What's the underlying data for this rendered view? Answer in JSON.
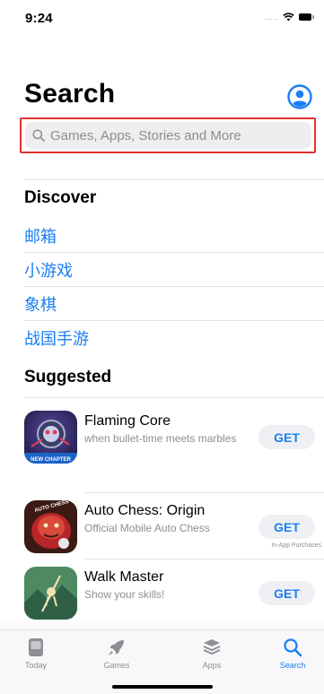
{
  "status_bar": {
    "time": "9:24",
    "signal_text": "....."
  },
  "header": {
    "title": "Search"
  },
  "search": {
    "placeholder": "Games, Apps, Stories and More",
    "value": ""
  },
  "discover": {
    "title": "Discover",
    "items": [
      "邮箱",
      "小游戏",
      "象棋",
      "战国手游"
    ]
  },
  "suggested": {
    "title": "Suggested",
    "apps": [
      {
        "name": "Flaming Core",
        "subtitle": "when bullet-time meets marbles",
        "button": "GET",
        "icon_caption": "NEW CHAPTER",
        "note": ""
      },
      {
        "name": "Auto Chess: Origin",
        "subtitle": "Official Mobile Auto Chess",
        "button": "GET",
        "icon_caption": "AUTO CHESS",
        "note": "In-App Purchases"
      },
      {
        "name": "Walk Master",
        "subtitle": "Show your skills!",
        "button": "GET",
        "icon_caption": "",
        "note": ""
      }
    ]
  },
  "tab_bar": {
    "tabs": [
      {
        "label": "Today",
        "icon": "today-icon",
        "active": false
      },
      {
        "label": "Games",
        "icon": "rocket-icon",
        "active": false
      },
      {
        "label": "Apps",
        "icon": "apps-stack-icon",
        "active": false
      },
      {
        "label": "Search",
        "icon": "search-icon",
        "active": true
      }
    ]
  },
  "colors": {
    "accent": "#1a7ef5",
    "highlight": "#e03131",
    "secondary_text": "#8e8e93"
  }
}
